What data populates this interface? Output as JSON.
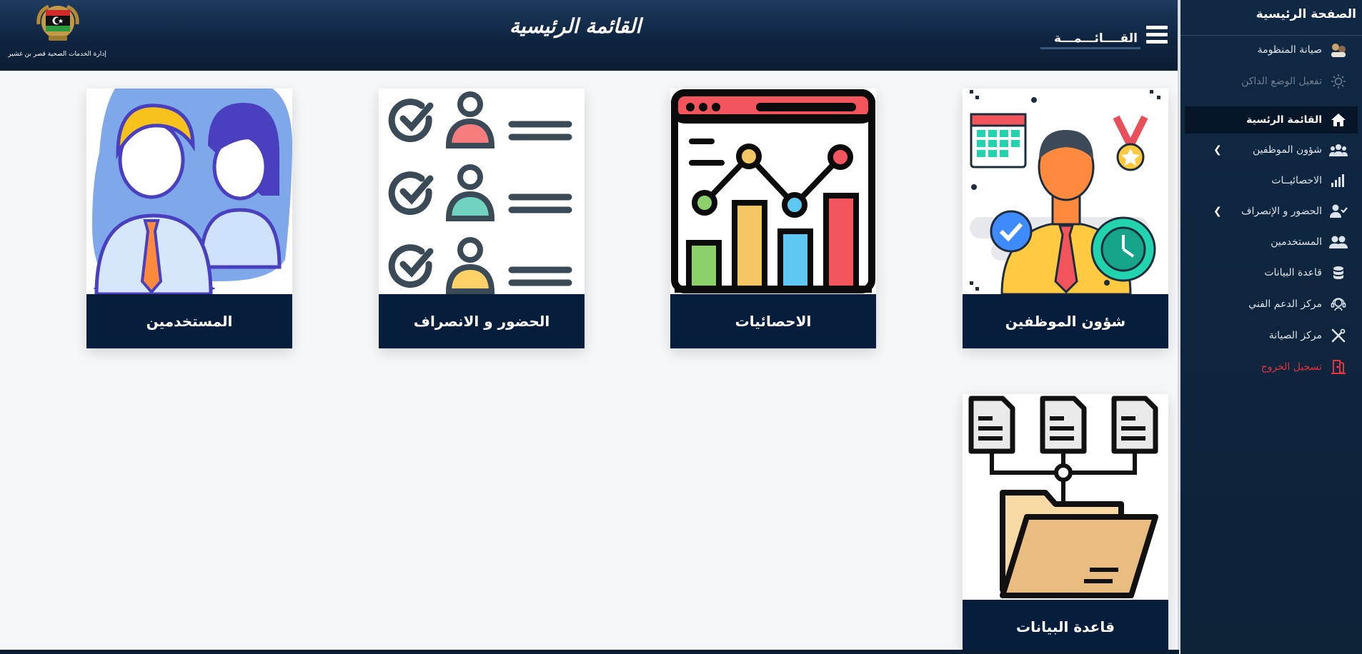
{
  "header": {
    "title": "القائمة الرئيسية",
    "agency_name": "إدارة الخدمات الصحية قصر بن غشير",
    "menu_label": "القــــائـــمـــة"
  },
  "sidebar": {
    "home_title": "الصفحة الرئيسية",
    "items": [
      {
        "label": "صيانة المنظومة",
        "icon": "maintenance-people-icon"
      },
      {
        "label": "تفعيل الوضع الداكن",
        "icon": "sun-icon"
      },
      {
        "label": "القائمة الرئسية",
        "icon": "home-icon"
      },
      {
        "label": "شؤون الموظفين",
        "icon": "users-group-icon"
      },
      {
        "label": "الاحصائيــات",
        "icon": "bar-signal-icon"
      },
      {
        "label": "الحضور و الإنصراف",
        "icon": "user-check-icon"
      },
      {
        "label": "المستخدمين",
        "icon": "users-icon"
      },
      {
        "label": "قاعدة البيانات",
        "icon": "database-icon"
      },
      {
        "label": "مركز الدعم الفني",
        "icon": "headset-icon"
      },
      {
        "label": "مركز الصيانة",
        "icon": "tools-icon"
      },
      {
        "label": "تسجيل الخروج",
        "icon": "logout-door-icon"
      }
    ],
    "danger_color": "#e0343f"
  },
  "cards": [
    {
      "label": "شؤون الموظفين",
      "icon": "employee-affairs-icon"
    },
    {
      "label": "الاحصائيات",
      "icon": "statistics-chart-icon"
    },
    {
      "label": "الحضور و الانصراف",
      "icon": "attendance-checklist-icon"
    },
    {
      "label": "المستخدمين",
      "icon": "users-illustration-icon"
    },
    {
      "label": "قاعدة البيانات",
      "icon": "database-folder-icon"
    }
  ],
  "colors": {
    "header": "#0f2540",
    "sidebar": "#102843",
    "card_caption": "#071d3c"
  }
}
